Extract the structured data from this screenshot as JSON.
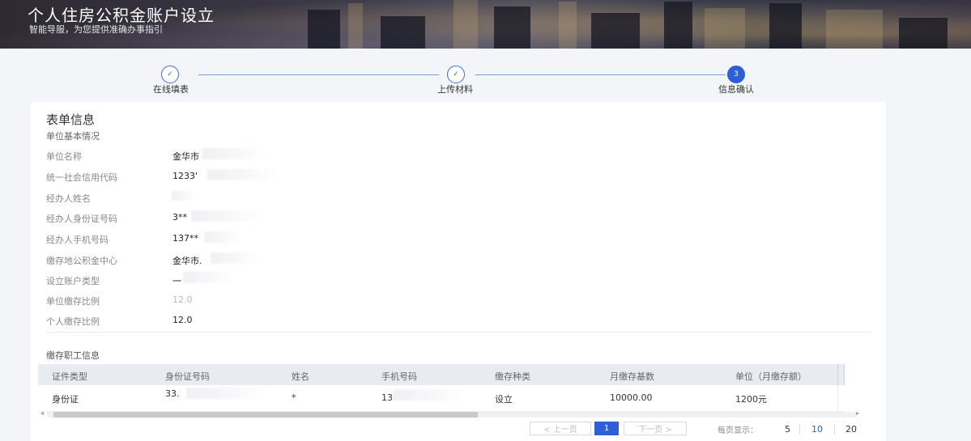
{
  "header": {
    "title": "个人住房公积金账户设立",
    "subtitle": "智能导服，为您提供准确办事指引"
  },
  "steps": [
    {
      "label": "在线填表",
      "status": "done",
      "mark": "✓"
    },
    {
      "label": "上传材料",
      "status": "done",
      "mark": "✓"
    },
    {
      "label": "信息确认",
      "status": "active",
      "mark": "3"
    }
  ],
  "form": {
    "title": "表单信息",
    "section": "单位基本情况",
    "fields": [
      {
        "label": "单位名称",
        "value": "金华市"
      },
      {
        "label": "统一社会信用代码",
        "value": "1233'"
      },
      {
        "label": "经办人姓名",
        "value": ""
      },
      {
        "label": "经办人身份证号码",
        "value": "3**"
      },
      {
        "label": "经办人手机号码",
        "value": "137**"
      },
      {
        "label": "缴存地公积金中心",
        "value": "金华市."
      },
      {
        "label": "设立账户类型",
        "value": "一"
      },
      {
        "label": "单位缴存比例",
        "value": "12.0"
      },
      {
        "label": "个人缴存比例",
        "value": "12.0"
      }
    ]
  },
  "employees": {
    "title": "缴存职工信息",
    "columns": [
      "证件类型",
      "身份证号码",
      "姓名",
      "手机号码",
      "缴存种类",
      "月缴存基数",
      "单位（月缴存额）"
    ],
    "rows": [
      [
        "身份证",
        "33.",
        "*",
        "13",
        "设立",
        "10000.00",
        "1200元"
      ]
    ]
  },
  "pagination": {
    "prev": "< 上一页",
    "next": "下一页 >",
    "current": "1",
    "per_page_label": "每页显示：",
    "sizes": [
      "5",
      "10",
      "20"
    ],
    "selected_size": "10"
  },
  "colors": {
    "accent": "#2e5fd6",
    "step_line": "#7b9cd8",
    "table_header": "#e8ebf1"
  }
}
